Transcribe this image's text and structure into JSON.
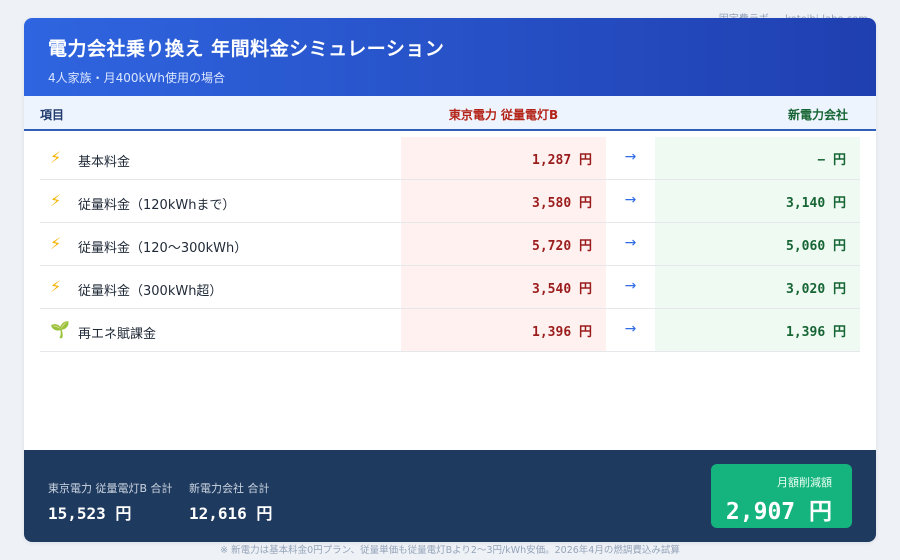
{
  "watermark": "固定費ラボ — koteihi-labo.com",
  "header": {
    "title": "電力会社乗り換え 年間料金シミュレーション",
    "subtitle": "4人家族・月400kWh使用の場合"
  },
  "table": {
    "columns": {
      "item": "項目",
      "tepco": "東京電力 従量電灯B",
      "new": "新電力会社"
    },
    "arrow": "→",
    "rows": [
      {
        "icon": "lightning-icon",
        "glyph": "⚡",
        "label": "基本料金",
        "tepco": "1,287 円",
        "new": "− 円"
      },
      {
        "icon": "lightning-icon",
        "glyph": "⚡",
        "label": "従量料金（120kWhまで）",
        "tepco": "3,580 円",
        "new": "3,140 円"
      },
      {
        "icon": "lightning-icon",
        "glyph": "⚡",
        "label": "従量料金（120〜300kWh）",
        "tepco": "5,720 円",
        "new": "5,060 円"
      },
      {
        "icon": "lightning-icon",
        "glyph": "⚡",
        "label": "従量料金（300kWh超）",
        "tepco": "3,540 円",
        "new": "3,020 円"
      },
      {
        "icon": "seedling-icon",
        "glyph": "🌱",
        "label": "再エネ賦課金",
        "tepco": "1,396 円",
        "new": "1,396 円"
      }
    ]
  },
  "footer": {
    "tepco_total_label": "東京電力 従量電灯B 合計",
    "tepco_total_value": "15,523 円",
    "new_total_label": "新電力会社 合計",
    "new_total_value": "12,616 円",
    "savings_label": "月額削減額",
    "savings_value": "2,907 円"
  },
  "note": "※ 新電力は基本料金0円プラン、従量単価も従量電灯Bより2〜3円/kWh安価。2026年4月の燃調費込み試算",
  "colors": {
    "header_start": "#2f65e0",
    "header_end": "#1f3fb0",
    "tepco_text": "#9b1c1c",
    "new_text": "#166534",
    "footer_bg": "#1f3a5f",
    "savings_bg": "#15b37d"
  }
}
